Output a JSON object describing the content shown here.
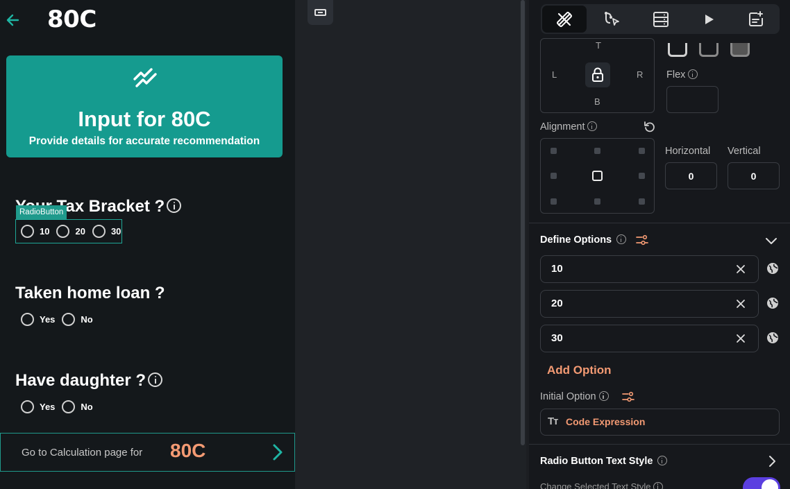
{
  "preview": {
    "title": "80C",
    "hero": {
      "title": "Input for 80C",
      "subtitle": "Provide details for accurate recommendation"
    },
    "questions": [
      {
        "title": "Your Tax Bracket ?",
        "options": [
          "10",
          "20",
          "30"
        ]
      },
      {
        "title": "Taken home loan ?",
        "options": [
          "Yes",
          "No"
        ]
      },
      {
        "title": "Have daughter ?",
        "options": [
          "Yes",
          "No"
        ]
      }
    ],
    "selection_tag": "RadioButton",
    "footer": {
      "text": "Go to Calculation  page for",
      "accent": "80C"
    }
  },
  "panel": {
    "padding": {
      "top": "T",
      "left": "L",
      "right": "R",
      "bottom": "B"
    },
    "flex_label": "Flex",
    "alignment_label": "Alignment",
    "horizontal_label": "Horizontal",
    "vertical_label": "Vertical",
    "horizontal_value": "0",
    "vertical_value": "0",
    "define_options_title": "Define Options",
    "options": [
      "10",
      "20",
      "30"
    ],
    "add_option_label": "Add Option",
    "initial_option_label": "Initial Option",
    "code_expression_icon": "Tт",
    "code_expression_label": "Code Expression",
    "text_style_title": "Radio Button Text Style",
    "change_selected_label": "Change Selected Text Style"
  },
  "colors": {
    "accent_teal": "#159b8f",
    "accent_orange": "#f39a73",
    "toggle_purple": "#5b3fe0"
  }
}
